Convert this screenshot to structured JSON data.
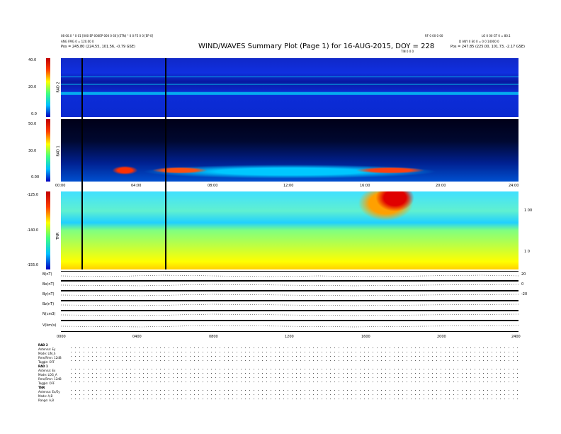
{
  "header": {
    "title": "WIND/WAVES Summary Plot (Page 1) for 16-AUG-2015, DOY = 228",
    "left_line1": "08 00.0 ° 0 01 [000 EP 000EP 000 0 60] (ETN) ° 0 0 FE 0 0 [EP 0]",
    "left_line2": "ANG FMG 0 = 120.00 0",
    "left_line3": "Pos = 245.80 (224.55, 101.56, -0.79 GSE)",
    "right_line1": "LO 0 00 GT 0 = 80.1",
    "right_line2": "D ANY 0 E0 0 = 0 0 14000 0",
    "right_line3": "Pos = 247.85 (225.00, 101.73, -2.17 GSE)",
    "center_small": "RF 0 00 0 00",
    "hours_label": "TIN 0 0 0"
  },
  "panels": {
    "rad1": {
      "label": "RAD 2",
      "ticks": [
        "40.0",
        "20.0",
        "0.0"
      ]
    },
    "rad2": {
      "label": "RAD 1",
      "ticks": [
        "50.0",
        "30.0",
        "0.00"
      ]
    },
    "tnr": {
      "label": "TNR",
      "ticks": [
        "-125.0",
        "-140.0",
        "-155.0"
      ],
      "right_ticks": [
        "1 00",
        "1 0"
      ]
    }
  },
  "time_axis": {
    "labels_mid": [
      "00:00",
      "04:00",
      "08:00",
      "12:00",
      "16:00",
      "20:00",
      "24:00"
    ],
    "labels_bottom": [
      "0000",
      "0400",
      "0800",
      "1200",
      "1600",
      "2000",
      "2400"
    ]
  },
  "strips": {
    "labels": [
      "B(nT)",
      "Bx(nT)",
      "By(nT)",
      "Bz(nT)",
      "N(cm3)",
      "V(km/s)"
    ],
    "right_vals": [
      "20",
      "0",
      "-20",
      "",
      "",
      ""
    ]
  },
  "footer": {
    "block1_title": "RAD 2",
    "block1_rows": [
      "Antenna:  Ey",
      "Mode:    LIN_S",
      "Rmx/Rmn:  12dB",
      "Toggle:   OFF"
    ],
    "block2_title": "RAD 1",
    "block2_rows": [
      "Antenna:  Ex",
      "Mode:    LOG_A",
      "Rmx/Rmn:  12dB",
      "Toggle:   OFF"
    ],
    "block3_title": "TNR",
    "block3_rows": [
      "Antenna:  Ex/Ey",
      "Mode:     A,B",
      "Range:    A,B"
    ]
  },
  "chart_data": {
    "type": "heatmap",
    "title": "WIND/WAVES Summary Plot (Page 1) for 16-AUG-2015, DOY = 228",
    "x": [
      "00:00",
      "04:00",
      "08:00",
      "12:00",
      "16:00",
      "20:00",
      "24:00"
    ],
    "panels": [
      {
        "name": "RAD 2",
        "ylim": [
          0,
          40
        ]
      },
      {
        "name": "RAD 1",
        "ylim": [
          0,
          50
        ]
      },
      {
        "name": "TNR",
        "ylim": [
          -155,
          -125
        ]
      }
    ],
    "colors": {
      "low": "#0000c0",
      "mid": "#40ff80",
      "high": "#c00000"
    }
  }
}
